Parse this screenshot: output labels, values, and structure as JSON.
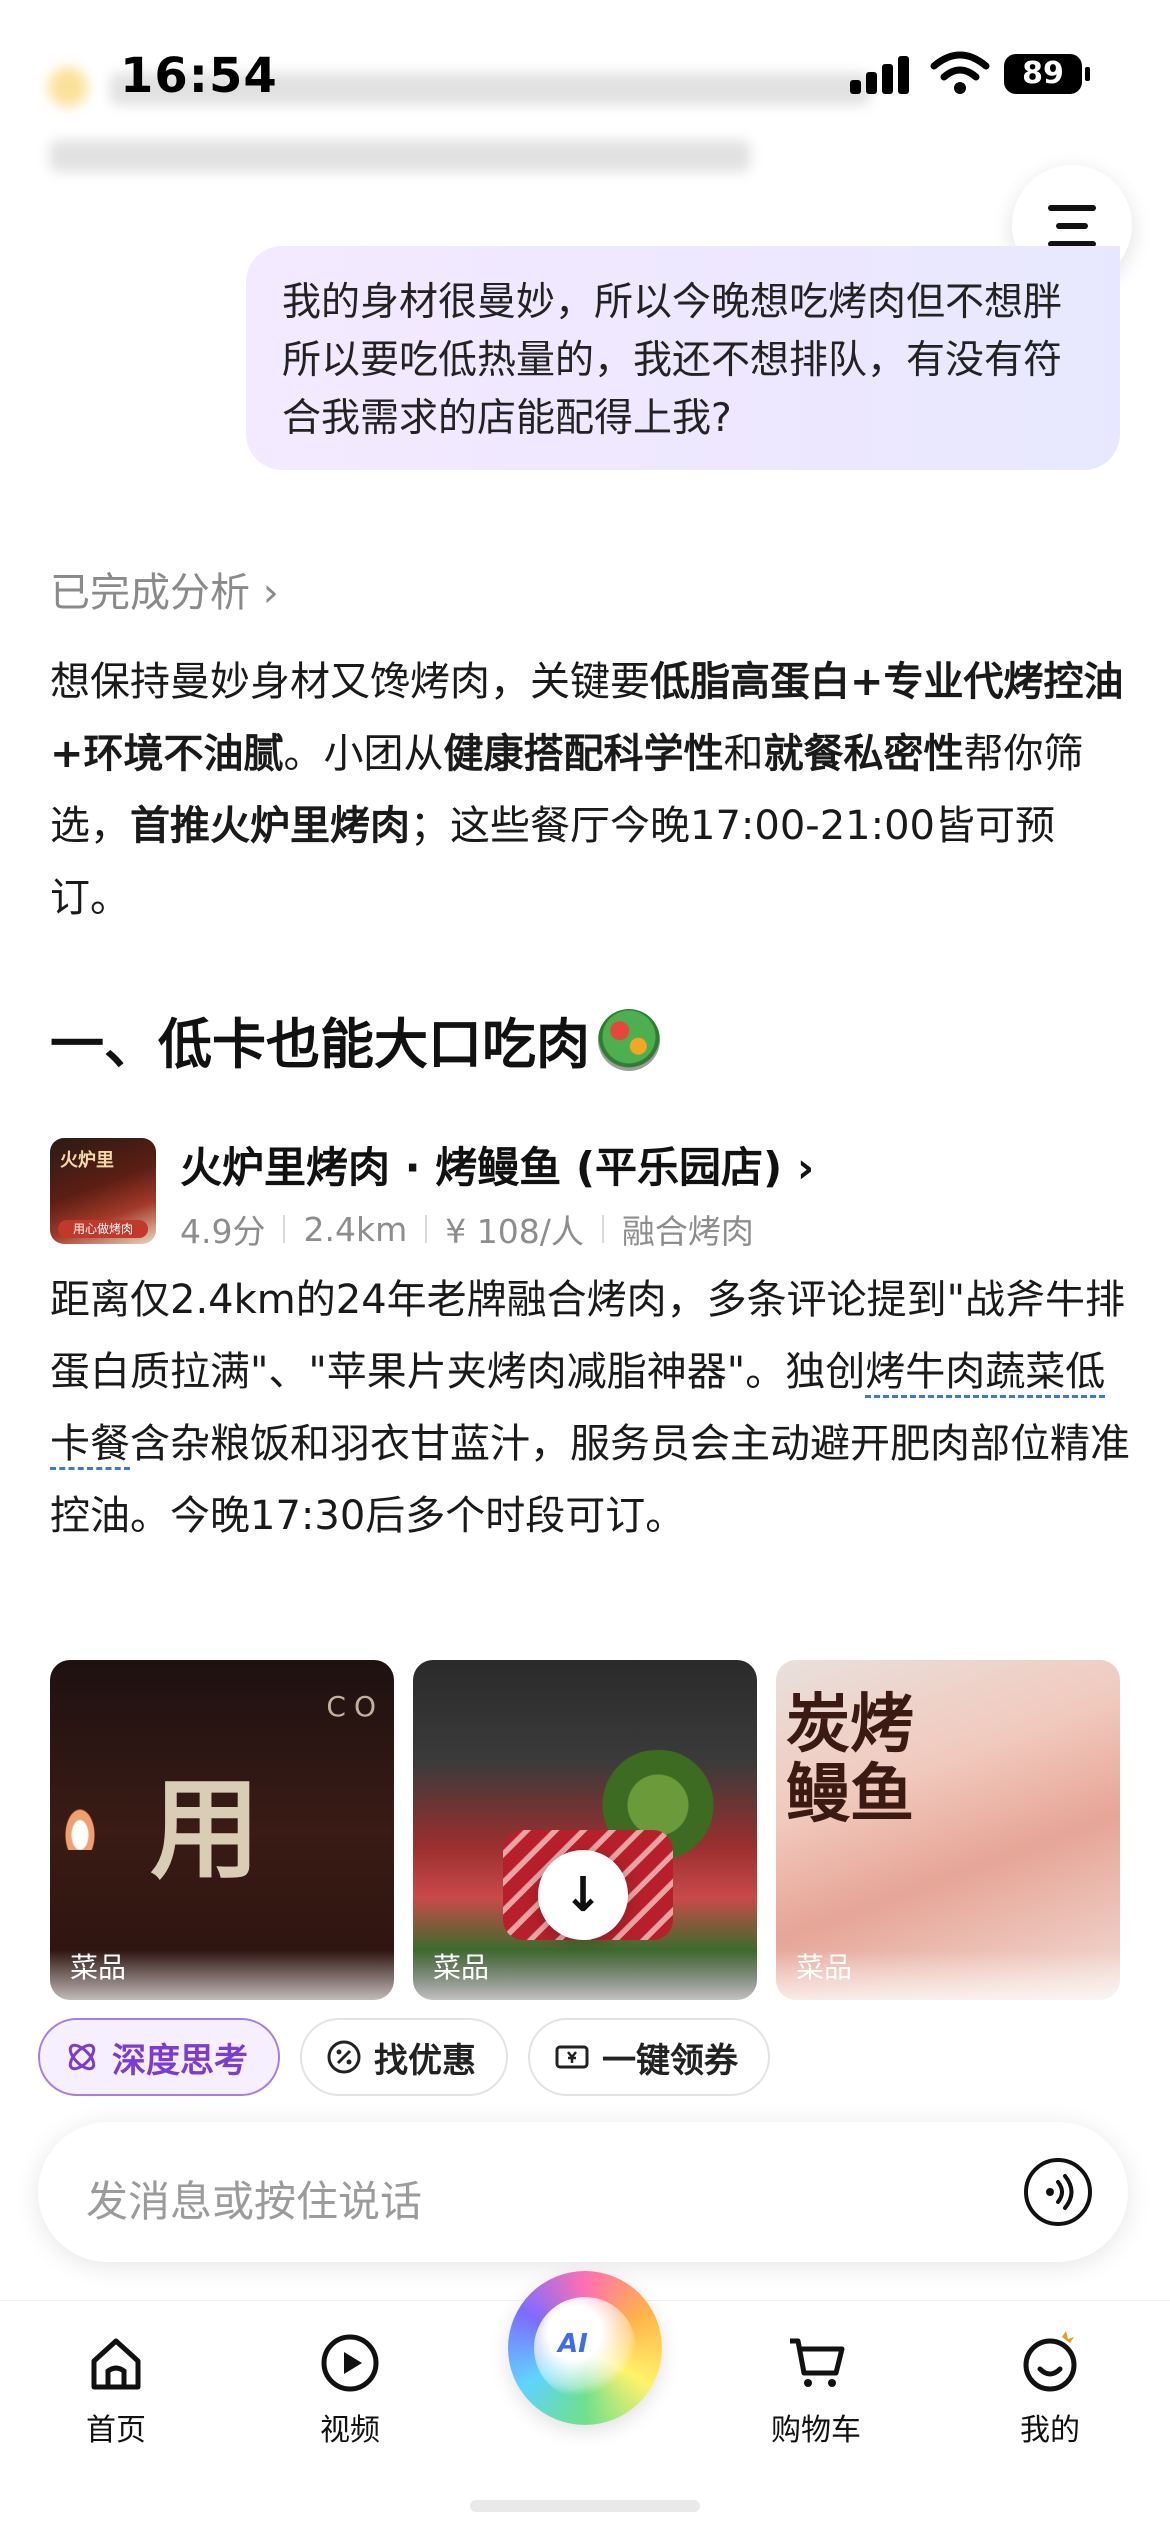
{
  "status_bar": {
    "time": "16:54",
    "battery": "89"
  },
  "user_message": "我的身材很曼妙，所以今晚想吃烤肉但不想胖所以要吃低热量的，我还不想排队，有没有符合我需求的店能配得上我?",
  "analysis": {
    "link_label": "已完成分析 ›",
    "p1": "想保持曼妙身材又馋烤肉，关键要",
    "b1": "低脂高蛋白+专业代烤控油+环境不油腻",
    "p2": "。小团从",
    "b2": "健康搭配科学性",
    "p3": "和",
    "b3": "就餐私密性",
    "p4": "帮你筛选，",
    "b4": "首推火炉里烤肉",
    "p5": "；这些餐厅今晚17:00-21:00皆可预订。"
  },
  "section": {
    "title": "一、低卡也能大口吃肉",
    "icon": "salad-icon"
  },
  "shop": {
    "logo_top": "火炉里",
    "logo_bottom": "用心做烤肉",
    "name": "火炉里烤肉 · 烤鳗鱼 (平乐园店) ›",
    "rating": "4.9分",
    "distance": "2.4km",
    "price": "¥ 108/人",
    "category": "融合烤肉",
    "desc_a": "距离仅2.4km的24年老牌融合烤肉，多条评论提到\"战斧牛排蛋白质拉满\"、\"苹果片夹烤肉减脂神器\"。独创",
    "desc_link": "烤牛肉蔬菜低卡餐",
    "desc_b": "含杂粮饭和羽衣甘蓝汁，服务员会主动避开肥肉部位精准控油。今晚17:30后多个时段可订。"
  },
  "photos": [
    {
      "tag": "菜品",
      "big_text": "用",
      "corner_text": "CO"
    },
    {
      "tag": "菜品"
    },
    {
      "tag": "菜品",
      "overlay_text": "炭烤鳗鱼"
    }
  ],
  "chips": [
    {
      "label": "深度思考",
      "icon": "deep-think-icon"
    },
    {
      "label": "找优惠",
      "icon": "discount-icon"
    },
    {
      "label": "一键领券",
      "icon": "coupon-icon"
    }
  ],
  "input": {
    "placeholder": "发消息或按住说话"
  },
  "tabbar": [
    {
      "label": "首页",
      "icon": "home-icon"
    },
    {
      "label": "视频",
      "icon": "play-icon"
    },
    {
      "label": "",
      "icon": "ai-assistant-icon"
    },
    {
      "label": "购物车",
      "icon": "cart-icon"
    },
    {
      "label": "我的",
      "icon": "profile-icon"
    }
  ],
  "colors": {
    "accent_purple": "#7a3bd6",
    "link_blue": "#3a7bd5",
    "bubble": "#efe8ff"
  }
}
